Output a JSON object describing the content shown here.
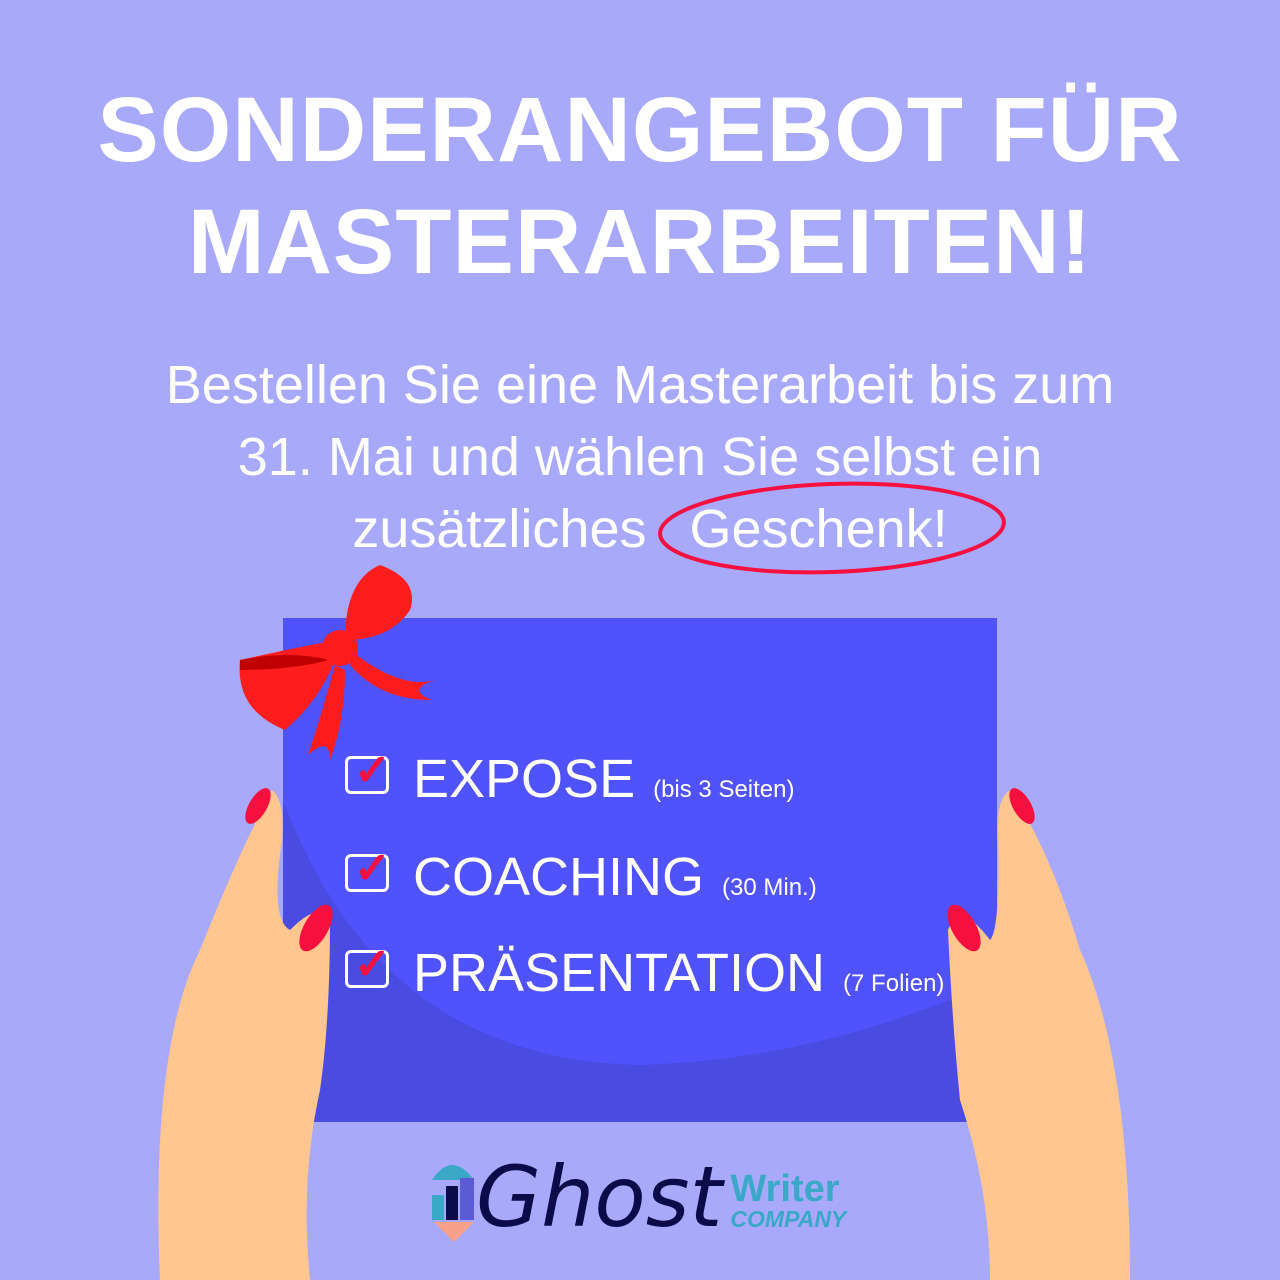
{
  "headline": {
    "line1": "SONDERANGEBOT FÜR",
    "line2": "MASTERARBEITEN!"
  },
  "subtitle": {
    "line1": "Bestellen Sie eine Masterarbeit bis zum",
    "line2": "31. Mai und wählen Sie selbst ein",
    "line3_prefix": "zusätzliches",
    "highlight": "Geschenk!"
  },
  "gifts": [
    {
      "label": "EXPOSE",
      "detail": "(bis 3 Seiten)"
    },
    {
      "label": "COACHING",
      "detail": "(30 Min.)"
    },
    {
      "label": "PRÄSENTATION",
      "detail": "(7 Folien)"
    }
  ],
  "logo": {
    "name": "Ghost",
    "writer": "Writer",
    "company": "COMPANY"
  },
  "colors": {
    "background": "#a9a9fb",
    "card": "#5052fb",
    "accent": "#f5103f",
    "skin": "#ffc690"
  }
}
